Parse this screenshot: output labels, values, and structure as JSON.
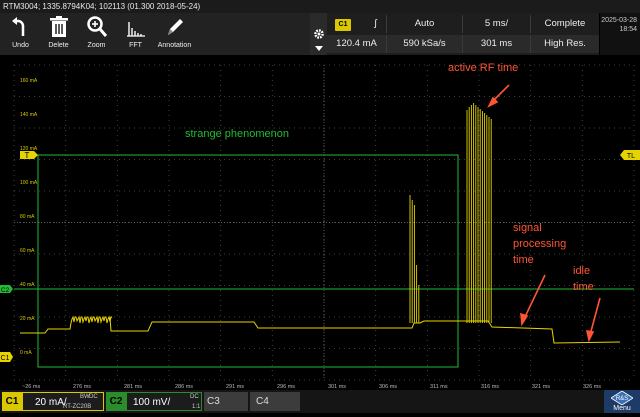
{
  "titlebar": {
    "text": "RTM3004; 1335.8794K04; 102113 (01.300 2018-05-24)"
  },
  "toolbar": {
    "undo": "Undo",
    "delete": "Delete",
    "zoom": "Zoom",
    "fft": "FFT",
    "annotation": "Annotation"
  },
  "acquisition": {
    "channel": "C1",
    "trigger_slope": "∫",
    "trigger_level": "120.4 mA",
    "mode": "Auto",
    "sample_rate": "590 kSa/s",
    "timebase": "5 ms/",
    "record_time": "301 ms",
    "status": "Complete",
    "resolution": "High Res."
  },
  "clock": {
    "date": "2025-03-28",
    "time": "18:54"
  },
  "scope": {
    "y_labels": [
      "160 mA",
      "140 mA",
      "120 mA",
      "100 mA",
      "80 mA",
      "60 mA",
      "40 mA",
      "20 mA",
      "0 mA"
    ],
    "x_labels": [
      "~26 ms",
      "276 ms",
      "281 ms",
      "286 ms",
      "291 ms",
      "296 ms",
      "301 ms",
      "306 ms",
      "311 ms",
      "316 ms",
      "321 ms",
      "326 ms"
    ],
    "markers": {
      "trigger": "T",
      "trigger_level": "TL",
      "ch2": "C2",
      "ch1": "C1"
    },
    "annotations": {
      "active_rf": "active RF time",
      "strange": "strange phenomenon",
      "signal_processing": "signal\nprocessing\ntime",
      "idle": "idle\ntime"
    },
    "colors": {
      "trace": "#e6d400",
      "ch2": "#22bb33",
      "annotation_red": "#ff5533"
    }
  },
  "bottom": {
    "c1": {
      "tag": "C1",
      "scale": "20 mA/",
      "coupling": "DC",
      "probe": "RT-ZC20B",
      "bw": "BW"
    },
    "c2": {
      "tag": "C2",
      "scale": "100 mV/",
      "coupling": "DC",
      "ratio": "1:1"
    },
    "c3": {
      "tag": "C3"
    },
    "c4": {
      "tag": "C4"
    },
    "menu": "Menu"
  }
}
